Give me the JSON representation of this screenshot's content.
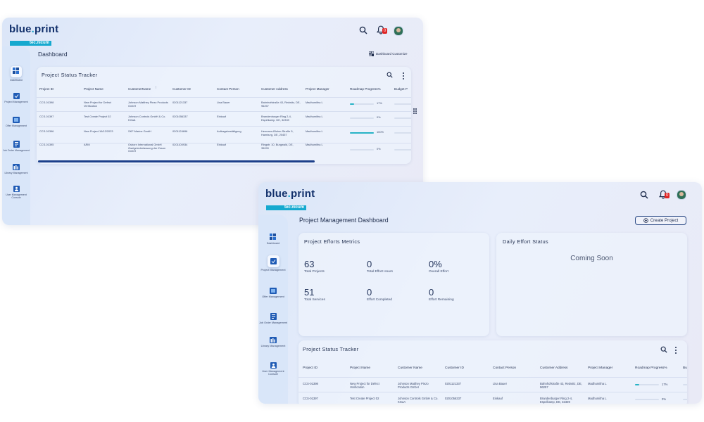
{
  "brand": {
    "word_left": "blue",
    "word_right": "print",
    "sub": "tec.nicum"
  },
  "notification_badge": "0",
  "nav": [
    {
      "label": "Dashboard"
    },
    {
      "label": "Project Management"
    },
    {
      "label": "Offer Management"
    },
    {
      "label": "Job Order Management"
    },
    {
      "label": "Library Management"
    },
    {
      "label": "User Management Console"
    }
  ],
  "screen1": {
    "page_title": "Dashboard",
    "customize_label": "Dashboard Customize",
    "tracker_title": "Project Status Tracker",
    "columns": [
      "Project ID",
      "Project Name",
      "CustomerName",
      "Customer ID",
      "Contact Person",
      "Customer Address",
      "Project Manager",
      "Roadmap Progress%",
      "Budget P"
    ],
    "rows": [
      {
        "id": "CCS-01398",
        "name": "New Project for Defect Verification",
        "customer": "Johnson Matthey Piezo Products GmbH",
        "cust_id": "0201121337",
        "contact": "Lisa Bauer",
        "address": "Bahnhofstraße 43, Redwitz, DE, 96257",
        "manager": "Madhumitha L",
        "progress": 17,
        "progress_label": "17%"
      },
      {
        "id": "CCS-01397",
        "name": "Test Create Project 02",
        "customer": "Johnson Controls GmbH & Co. KGaA",
        "cust_id": "0201056337",
        "contact": "Einkauf",
        "address": "Brandenburger Ring 2-4, Espelkamp, DE, 32339",
        "manager": "Madhumitha L",
        "progress": 0,
        "progress_label": "0%"
      },
      {
        "id": "CCS-01396",
        "name": "New Project 16/12/2023",
        "customer": "SKF Marine GmbH",
        "cust_id": "0201124696",
        "contact": "Auftragsbestätigung",
        "address": "Hermann-Blohm-Straße 5, Hamburg, DE, 20457",
        "manager": "Madhumitha L",
        "progress": 100,
        "progress_label": "100%"
      },
      {
        "id": "CCS-01395",
        "name": "ARM",
        "customer": "Osborn International GmbH Zweigniederlassung der Zeson GmbH",
        "cust_id": "0201100934",
        "contact": "Einkauf",
        "address": "Ringstr. 10, Burgwald, DE, 35099",
        "manager": "Madhumitha L",
        "progress": 0,
        "progress_label": "0%"
      }
    ]
  },
  "screen2": {
    "page_title": "Project Management Dashboard",
    "create_button": "Create Project",
    "metrics_title": "Project Efforts Metrics",
    "metrics": [
      {
        "value": "63",
        "label": "Total Projects"
      },
      {
        "value": "0",
        "label": "Total Effort Hours"
      },
      {
        "value": "0%",
        "label": "Overall Effort"
      },
      {
        "value": "51",
        "label": "Total Services"
      },
      {
        "value": "0",
        "label": "Effort Completed"
      },
      {
        "value": "0",
        "label": "Effort Remaining"
      }
    ],
    "daily_title": "Daily Effort Status",
    "coming_soon": "Coming Soon",
    "tracker_title": "Project Status Tracker",
    "columns": [
      "Project ID",
      "Project Name",
      "Customer Name",
      "Customer ID",
      "Contact Person",
      "Customer Address",
      "Project Manager",
      "Roadmap Progress%",
      "Bu"
    ],
    "rows": [
      {
        "id": "CCS-01398",
        "name": "New Project for Defect Verification",
        "customer": "Johnson Matthey Piezo Products GmbH",
        "cust_id": "0201121337",
        "contact": "Lisa Bauer",
        "address": "Bahnhofstraße 43, Redwitz, DE, 96257",
        "manager": "Madhumitha L",
        "progress": 17,
        "progress_label": "17%"
      },
      {
        "id": "CCS-01397",
        "name": "Test Create Project 02",
        "customer": "Johnson Controls GmbH & Co. KGaA",
        "cust_id": "0201056337",
        "contact": "Einkauf",
        "address": "Brandenburger Ring 2-4, Espelkamp, DE, 32339",
        "manager": "Madhumitha L",
        "progress": 0,
        "progress_label": "0%"
      }
    ]
  },
  "colors": {
    "brand_dark": "#12306b",
    "brand_accent": "#15a9cf",
    "badge_red": "#e02424",
    "progress_fill": "#27b3c6",
    "scrollbar": "#1c3f8a"
  }
}
